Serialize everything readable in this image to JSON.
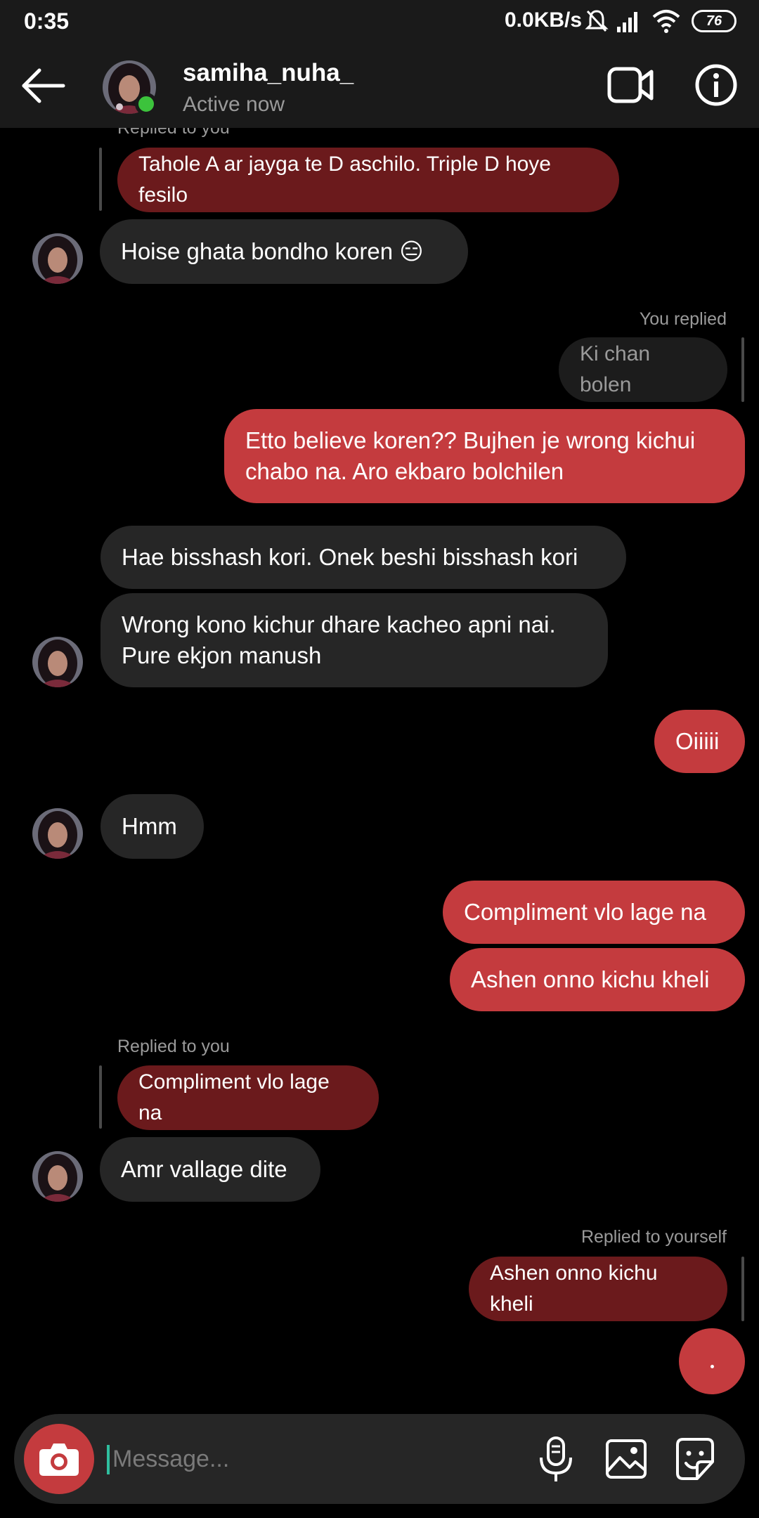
{
  "status_bar": {
    "time": "0:35",
    "network_speed": "0.0KB/s",
    "battery": "76",
    "icons": [
      "mute-icon",
      "signal-icon",
      "wifi-icon",
      "battery-icon"
    ]
  },
  "header": {
    "username": "samiha_nuha_",
    "status": "Active now",
    "icons": [
      "back-arrow-icon",
      "video-call-icon",
      "info-icon"
    ]
  },
  "messages": {
    "m1_meta": "Replied to you",
    "m1_quote": "Tahole A ar jayga te D aschilo. Triple D hoye fesilo",
    "m2_text": "Hoise ghata bondho koren 😑",
    "m3_meta": "You replied",
    "m3_quote": "Ki chan bolen",
    "m4_text": "Etto believe koren?? Bujhen je wrong kichui\nchabo na. Aro ekbaro bolchilen",
    "m5_text": "Hae bisshash kori. Onek beshi bisshash kori",
    "m6_text": "Wrong kono kichur dhare kacheo apni nai.\nPure ekjon manush",
    "m7_text": "Oiiiii",
    "m8_text": "Hmm",
    "m9_text": "Compliment vlo lage na",
    "m10_text": "Ashen onno kichu kheli",
    "m11_meta": "Replied to you",
    "m11_quote": "Compliment vlo lage na",
    "m12_text": "Amr vallage dite",
    "m13_meta": "Replied to yourself",
    "m13_quote": "Ashen onno kichu kheli"
  },
  "composer": {
    "placeholder": "Message...",
    "icons": [
      "camera-icon",
      "microphone-icon",
      "gallery-icon",
      "sticker-icon"
    ]
  },
  "colors": {
    "outgoing_bubble": "#c43b3e",
    "incoming_bubble": "#262626",
    "reply_quote": "#6b1a1c",
    "online": "#3cc33c",
    "background": "#000000"
  }
}
